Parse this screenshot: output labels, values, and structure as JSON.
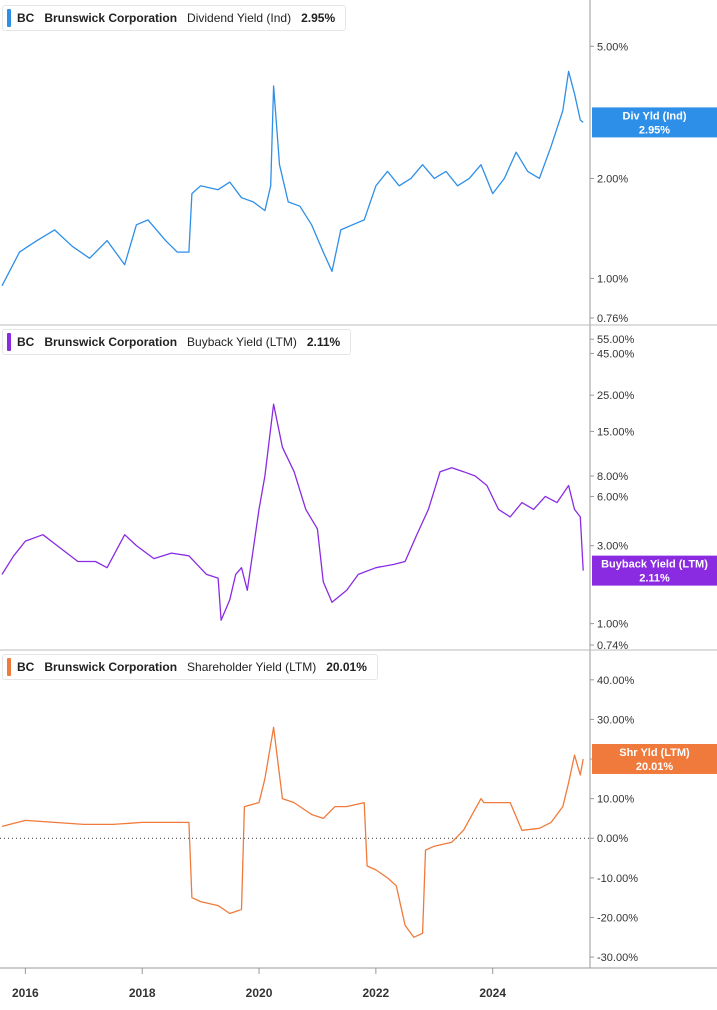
{
  "panels": [
    {
      "legend": {
        "ticker": "BC",
        "company": "Brunswick Corporation",
        "metric": "Dividend Yield (Ind)",
        "value": "2.95%"
      },
      "color": "#2e8fe8",
      "badge": {
        "line1": "Div Yld (Ind)",
        "line2": "2.95%"
      },
      "yticks": [
        "5.00%",
        "2.00%",
        "1.00%",
        "0.76%"
      ]
    },
    {
      "legend": {
        "ticker": "BC",
        "company": "Brunswick Corporation",
        "metric": "Buyback Yield (LTM)",
        "value": "2.11%"
      },
      "color": "#8a2be2",
      "badge": {
        "line1": "Buyback Yield (LTM)",
        "line2": "2.11%"
      },
      "yticks": [
        "55.00%",
        "45.00%",
        "25.00%",
        "15.00%",
        "8.00%",
        "6.00%",
        "3.00%",
        "1.00%",
        "0.74%"
      ]
    },
    {
      "legend": {
        "ticker": "BC",
        "company": "Brunswick Corporation",
        "metric": "Shareholder Yield (LTM)",
        "value": "20.01%"
      },
      "color": "#f07a3c",
      "badge": {
        "line1": "Shr Yld (LTM)",
        "line2": "20.01%"
      },
      "yticks": [
        "40.00%",
        "30.00%",
        "20.00%",
        "10.00%",
        "0.00%",
        "-10.00%",
        "-20.00%",
        "-30.00%"
      ]
    }
  ],
  "xticks": [
    "2016",
    "2018",
    "2020",
    "2022",
    "2024"
  ],
  "chart_data": [
    {
      "type": "line",
      "xlabel": "",
      "ylabel": "",
      "log_scale": true,
      "series": [
        {
          "name": "Dividend Yield (Ind)",
          "color": "#2e8fe8",
          "x": [
            2015.6,
            2015.9,
            2016.2,
            2016.5,
            2016.8,
            2017.1,
            2017.4,
            2017.7,
            2017.9,
            2018.1,
            2018.4,
            2018.6,
            2018.8,
            2018.85,
            2019.0,
            2019.3,
            2019.5,
            2019.7,
            2019.9,
            2020.1,
            2020.2,
            2020.25,
            2020.35,
            2020.5,
            2020.7,
            2020.9,
            2021.1,
            2021.25,
            2021.4,
            2021.6,
            2021.8,
            2022.0,
            2022.2,
            2022.4,
            2022.6,
            2022.8,
            2023.0,
            2023.2,
            2023.4,
            2023.6,
            2023.8,
            2024.0,
            2024.2,
            2024.4,
            2024.6,
            2024.8,
            2025.0,
            2025.2,
            2025.3,
            2025.4,
            2025.5,
            2025.55
          ],
          "values": [
            0.95,
            1.2,
            1.3,
            1.4,
            1.25,
            1.15,
            1.3,
            1.1,
            1.45,
            1.5,
            1.3,
            1.2,
            1.2,
            1.8,
            1.9,
            1.85,
            1.95,
            1.75,
            1.7,
            1.6,
            1.9,
            3.8,
            2.2,
            1.7,
            1.65,
            1.45,
            1.2,
            1.05,
            1.4,
            1.45,
            1.5,
            1.9,
            2.1,
            1.9,
            2.0,
            2.2,
            2.0,
            2.1,
            1.9,
            2.0,
            2.2,
            1.8,
            2.0,
            2.4,
            2.1,
            2.0,
            2.5,
            3.2,
            4.2,
            3.6,
            3.0,
            2.95
          ]
        }
      ],
      "ylim": [
        0.76,
        6.0
      ]
    },
    {
      "type": "line",
      "xlabel": "",
      "ylabel": "",
      "log_scale": true,
      "series": [
        {
          "name": "Buyback Yield (LTM)",
          "color": "#8a2be2",
          "x": [
            2015.6,
            2015.8,
            2016.0,
            2016.3,
            2016.6,
            2016.9,
            2017.2,
            2017.4,
            2017.7,
            2017.9,
            2018.2,
            2018.5,
            2018.8,
            2019.1,
            2019.3,
            2019.35,
            2019.5,
            2019.6,
            2019.7,
            2019.8,
            2020.0,
            2020.1,
            2020.25,
            2020.4,
            2020.6,
            2020.8,
            2021.0,
            2021.1,
            2021.25,
            2021.5,
            2021.7,
            2022.0,
            2022.3,
            2022.5,
            2022.7,
            2022.9,
            2023.1,
            2023.3,
            2023.5,
            2023.7,
            2023.9,
            2024.1,
            2024.3,
            2024.5,
            2024.7,
            2024.9,
            2025.1,
            2025.3,
            2025.4,
            2025.5,
            2025.55
          ],
          "values": [
            2.0,
            2.6,
            3.2,
            3.5,
            2.9,
            2.4,
            2.4,
            2.2,
            3.5,
            3.0,
            2.5,
            2.7,
            2.6,
            2.0,
            1.9,
            1.05,
            1.4,
            2.0,
            2.2,
            1.6,
            5.0,
            8.0,
            22.0,
            12.0,
            8.5,
            5.0,
            3.8,
            1.8,
            1.35,
            1.6,
            2.0,
            2.2,
            2.3,
            2.4,
            3.5,
            5.0,
            8.5,
            9.0,
            8.5,
            8.0,
            7.0,
            5.0,
            4.5,
            5.5,
            5.0,
            6.0,
            5.5,
            7.0,
            5.0,
            4.5,
            2.11
          ]
        }
      ],
      "ylim": [
        0.74,
        60.0
      ]
    },
    {
      "type": "line",
      "xlabel": "",
      "ylabel": "",
      "log_scale": false,
      "series": [
        {
          "name": "Shareholder Yield (LTM)",
          "color": "#f07a3c",
          "x": [
            2015.6,
            2016.0,
            2016.5,
            2017.0,
            2017.5,
            2018.0,
            2018.5,
            2018.8,
            2018.85,
            2019.0,
            2019.3,
            2019.5,
            2019.7,
            2019.75,
            2020.0,
            2020.1,
            2020.25,
            2020.4,
            2020.6,
            2020.9,
            2021.1,
            2021.3,
            2021.5,
            2021.8,
            2021.85,
            2022.0,
            2022.2,
            2022.35,
            2022.5,
            2022.65,
            2022.8,
            2022.85,
            2023.0,
            2023.3,
            2023.5,
            2023.8,
            2023.85,
            2024.0,
            2024.3,
            2024.5,
            2024.8,
            2025.0,
            2025.2,
            2025.3,
            2025.4,
            2025.5,
            2025.55
          ],
          "values": [
            3.0,
            4.5,
            4.0,
            3.5,
            3.5,
            4.0,
            4.0,
            4.0,
            -15.0,
            -16.0,
            -17.0,
            -19.0,
            -18.0,
            8.0,
            9.0,
            15.0,
            28.0,
            10.0,
            9.0,
            6.0,
            5.0,
            8.0,
            8.0,
            9.0,
            -7.0,
            -8.0,
            -10.0,
            -12.0,
            -22.0,
            -25.0,
            -24.0,
            -3.0,
            -2.0,
            -1.0,
            2.0,
            10.0,
            9.0,
            9.0,
            9.0,
            2.0,
            2.5,
            4.0,
            8.0,
            14.0,
            21.0,
            16.0,
            20.01
          ]
        }
      ],
      "ylim": [
        -32.0,
        45.0
      ]
    }
  ]
}
